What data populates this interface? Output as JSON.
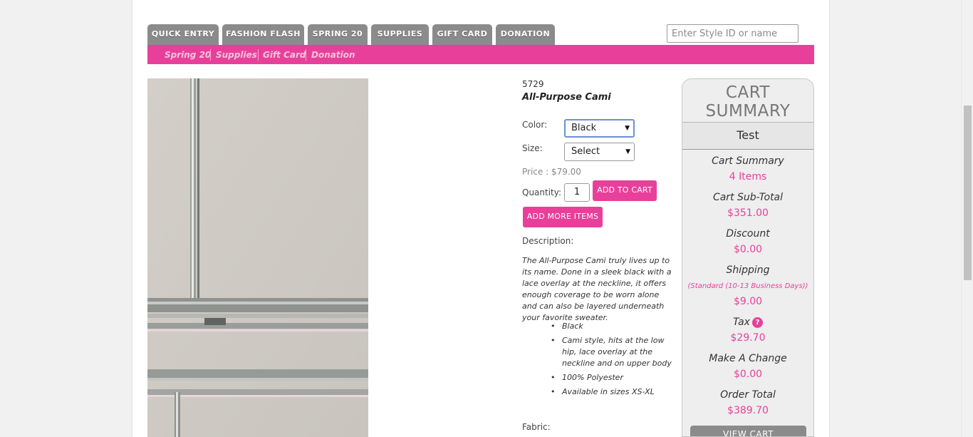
{
  "nav": {
    "tabs": [
      {
        "label": "QUICK ENTRY"
      },
      {
        "label": "FASHION FLASH"
      },
      {
        "label": "SPRING 20"
      },
      {
        "label": "SUPPLIES"
      },
      {
        "label": "GIFT CARD"
      },
      {
        "label": "DONATION"
      }
    ],
    "search_placeholder": "Enter Style ID or name",
    "subnav": [
      "Spring 20",
      "Supplies",
      "Gift Card",
      "Donation"
    ]
  },
  "product": {
    "style_id": "5729",
    "name": "All-Purpose Cami",
    "color_label": "Color:",
    "color_value": "Black",
    "size_label": "Size:",
    "size_value": "Select",
    "price": "Price : $79.00",
    "quantity_label": "Quantity:",
    "quantity_value": "1",
    "add_to_cart": "ADD TO CART",
    "add_more": "ADD MORE ITEMS",
    "description_label": "Description:",
    "description": "The All-Purpose Cami truly lives up to its name. Done in a sleek black with a lace overlay at the neckline, it offers enough coverage to be worn alone and can also be layered underneath your favorite sweater.",
    "bullets": [
      "Black",
      "Cami style, hits at the low hip, lace overlay at the neckline and on upper body",
      "100% Polyester",
      "Available in sizes XS-XL"
    ],
    "fabric_label": "Fabric:"
  },
  "cart": {
    "title": "CART SUMMARY",
    "user": "Test",
    "summary_label": "Cart Summary",
    "items": "4 Items",
    "subtotal_label": "Cart Sub-Total",
    "subtotal": "$351.00",
    "discount_label": "Discount",
    "discount": "$0.00",
    "shipping_label": "Shipping",
    "shipping_method": "(Standard (10-13 Business Days))",
    "shipping": "$9.00",
    "tax_label": "Tax",
    "tax_help": "?",
    "tax": "$29.70",
    "change_label": "Make A Change",
    "change": "$0.00",
    "total_label": "Order Total",
    "total": "$389.70",
    "view_cart": "VIEW CART"
  },
  "colors": {
    "accent": "#e8409a",
    "tab": "#8b8b8b"
  }
}
